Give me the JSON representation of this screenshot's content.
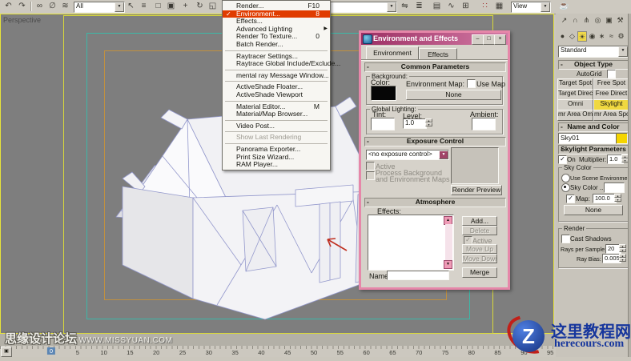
{
  "colors": {
    "menu_highlight": "#e03c00",
    "dialog_border": "#e687a9",
    "titlebar_left": "#9c2f63",
    "titlebar_right": "#d37ba6",
    "skylight_button": "#f0d840",
    "safe_live": "#d8d83a",
    "safe_action": "#3cb8a8",
    "safe_title": "#c09040",
    "viewport_bg": "#7e7e7e"
  },
  "toolbar": {
    "selection_filter_value": "All",
    "ref_coord_value": "View",
    "view_value": "View"
  },
  "viewport": {
    "label": "Perspective"
  },
  "menu": {
    "items": [
      {
        "label": "Render...",
        "shortcut": "F10"
      },
      {
        "label": "Environment...",
        "shortcut": "8"
      },
      {
        "label": "Effects...",
        "shortcut": ""
      },
      {
        "label": "Advanced Lighting",
        "shortcut": ""
      },
      {
        "label": "Render To Texture...",
        "shortcut": "0"
      },
      {
        "label": "Batch Render...",
        "shortcut": ""
      },
      {
        "label": "Raytracer Settings...",
        "shortcut": ""
      },
      {
        "label": "Raytrace Global Include/Exclude...",
        "shortcut": ""
      },
      {
        "label": "mental ray Message Window...",
        "shortcut": ""
      },
      {
        "label": "ActiveShade Floater...",
        "shortcut": ""
      },
      {
        "label": "ActiveShade Viewport",
        "shortcut": ""
      },
      {
        "label": "Material Editor...",
        "shortcut": "M"
      },
      {
        "label": "Material/Map Browser...",
        "shortcut": ""
      },
      {
        "label": "Video Post...",
        "shortcut": ""
      },
      {
        "label": "Show Last Rendering",
        "shortcut": ""
      },
      {
        "label": "Panorama Exporter...",
        "shortcut": ""
      },
      {
        "label": "Print Size Wizard...",
        "shortcut": ""
      },
      {
        "label": "RAM Player...",
        "shortcut": ""
      }
    ]
  },
  "dialog": {
    "title": "Environment and Effects",
    "tabs": [
      "Environment",
      "Effects"
    ],
    "common": {
      "header": "Common Parameters",
      "background_label": "Background:",
      "color_label": "Color:",
      "env_map_label": "Environment Map:",
      "use_map_label": "Use Map",
      "map_button": "None",
      "global_label": "Global Lighting:",
      "tint_label": "Tint:",
      "level_label": "Level:",
      "level_value": "1.0",
      "ambient_label": "Ambient:"
    },
    "exposure": {
      "header": "Exposure Control",
      "selected": "<no exposure control>",
      "active_label": "Active",
      "process_label_1": "Process Background",
      "process_label_2": "and Environment Maps",
      "render_preview": "Render Preview"
    },
    "atmosphere": {
      "header": "Atmosphere",
      "effects_label": "Effects:",
      "add": "Add...",
      "delete": "Delete",
      "active": "Active",
      "move_up": "Move Up",
      "move_down": "Move Down",
      "merge": "Merge",
      "name_label": "Name:",
      "name_value": ""
    }
  },
  "panel": {
    "category_dropdown": "Standard",
    "object_type": {
      "header": "Object Type",
      "autogrid": "AutoGrid",
      "buttons": [
        "Target Spot",
        "Free Spot",
        "Target Direct",
        "Free Direct",
        "Omni",
        "Skylight",
        "mr Area Omni",
        "mr Area Spot"
      ],
      "active_button": "Skylight"
    },
    "name_color": {
      "header": "Name and Color",
      "name_value": "Sky01"
    },
    "skylight": {
      "header": "Skylight Parameters",
      "on": "On",
      "multiplier_label": "Multiplier:",
      "multiplier_value": "1.0",
      "sky_color_group": "Sky Color",
      "use_scene": "Use Scene Environment",
      "sky_color_label": "Sky Color ...",
      "map_label": "Map:",
      "map_value": "100.0",
      "map_button": "None",
      "render_group": "Render",
      "cast_shadows": "Cast Shadows",
      "rays_label": "Rays per Sample:",
      "rays_value": "20",
      "bias_label": "Ray Bias:",
      "bias_value": "0.005"
    }
  },
  "timeline": {
    "labels": [
      "0",
      "5",
      "10",
      "15",
      "20",
      "25",
      "30",
      "35",
      "40",
      "45",
      "50",
      "55",
      "60",
      "65",
      "70",
      "75",
      "80",
      "85",
      "90",
      "95"
    ],
    "current": "0"
  },
  "watermarks": {
    "left": {
      "cjk": "思缘设计论坛",
      "url": "WWW.MISSYUAN.COM"
    },
    "right": {
      "cjk": "这里教程网",
      "url": "herecours.com",
      "logo_letter": "Z"
    }
  }
}
